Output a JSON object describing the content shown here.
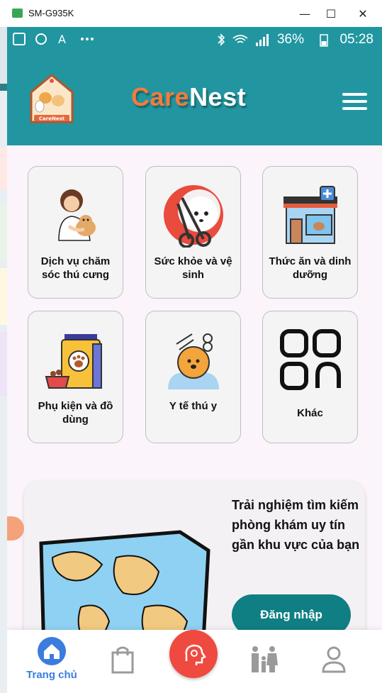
{
  "window": {
    "title": "SM-G935K",
    "controls": [
      "minimize",
      "maximize",
      "close"
    ]
  },
  "statusbar": {
    "battery": "36%",
    "time": "05:28",
    "left_icons": [
      "flipboard-icon",
      "shazam-icon",
      "ai-icon",
      "more-icon"
    ],
    "right_icons": [
      "bluetooth-icon",
      "lte-wifi-icon",
      "signal-icon",
      "battery-icon"
    ]
  },
  "header": {
    "logo_text": "CareNest",
    "brand_part1": "Care",
    "brand_part2": "Nest",
    "brand_colors": {
      "part1": "#f47b3c",
      "part2": "#ffffff",
      "bg": "#2196a0"
    }
  },
  "categories": [
    {
      "label": "Dịch vụ chăm sóc thú cưng",
      "icon": "pet-care-icon"
    },
    {
      "label": "Sức khỏe và vệ sinh",
      "icon": "grooming-icon"
    },
    {
      "label": "Thức ăn và dinh dưỡng",
      "icon": "pet-shop-icon"
    },
    {
      "label": "Phụ kiện và đồ dùng",
      "icon": "pet-food-icon"
    },
    {
      "label": "Y tế thú y",
      "icon": "dog-groomer-icon"
    },
    {
      "label": "Khác",
      "icon": "apps-grid-icon"
    }
  ],
  "promo": {
    "text": "Trải nghiệm tìm kiếm phòng khám uy tín gần khu vực của bạn",
    "button_label": "Đăng nhập",
    "image": "world-map-icon"
  },
  "bottom_nav": [
    {
      "label": "Trang chủ",
      "icon": "home-icon",
      "active": true
    },
    {
      "label": "",
      "icon": "shopping-bag-icon",
      "active": false
    },
    {
      "label": "",
      "icon": "brain-head-icon",
      "active": false
    },
    {
      "label": "",
      "icon": "family-icon",
      "active": false
    },
    {
      "label": "",
      "icon": "user-icon",
      "active": false
    }
  ],
  "colors": {
    "accent": "#3b7ddd",
    "fab": "#ef4a3f",
    "button": "#0f7f83"
  }
}
